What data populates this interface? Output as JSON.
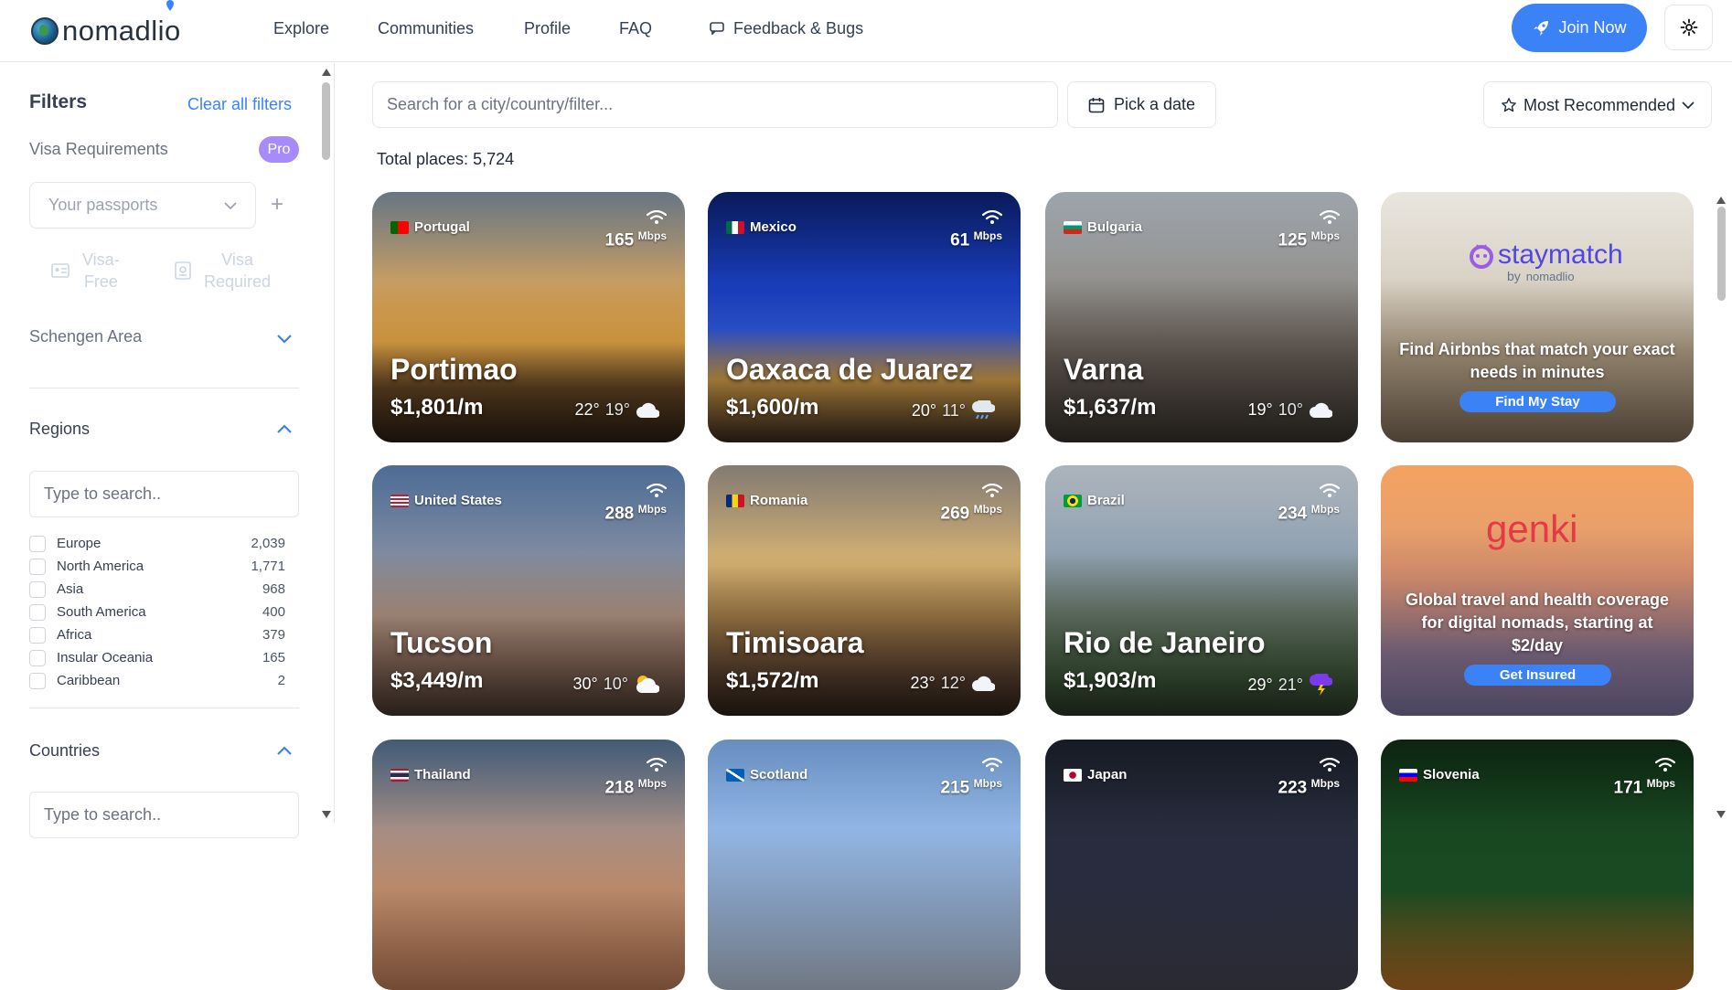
{
  "header": {
    "logo_text": "nomadlio",
    "nav": [
      "Explore",
      "Communities",
      "Profile",
      "FAQ"
    ],
    "feedback": "Feedback & Bugs",
    "join": "Join Now"
  },
  "sidebar": {
    "title": "Filters",
    "clear": "Clear all filters",
    "visa_label": "Visa Requirements",
    "pro": "Pro",
    "passports_placeholder": "Your passports",
    "visa_free": "Visa-\nFree",
    "visa_required": "Visa\nRequired",
    "schengen": "Schengen Area",
    "regions_title": "Regions",
    "regions_search": "Type to search..",
    "regions": [
      {
        "name": "Europe",
        "count": "2,039"
      },
      {
        "name": "North America",
        "count": "1,771"
      },
      {
        "name": "Asia",
        "count": "968"
      },
      {
        "name": "South America",
        "count": "400"
      },
      {
        "name": "Africa",
        "count": "379"
      },
      {
        "name": "Insular Oceania",
        "count": "165"
      },
      {
        "name": "Caribbean",
        "count": "2"
      }
    ],
    "countries_title": "Countries",
    "countries_search": "Type to search.."
  },
  "main": {
    "search_placeholder": "Search for a city/country/filter...",
    "date_label": "Pick a date",
    "sort_label": "Most Recommended",
    "total_label": "Total places: ",
    "total_value": "5,724",
    "mbps": "Mbps"
  },
  "cards": [
    {
      "country": "Portugal",
      "speed": "165",
      "city": "Portimao",
      "price": "$1,801/m",
      "high": "22°",
      "low": "19°",
      "weather": "cloud"
    },
    {
      "country": "Mexico",
      "speed": "61",
      "city": "Oaxaca de Juarez",
      "price": "$1,600/m",
      "high": "20°",
      "low": "11°",
      "weather": "rain"
    },
    {
      "country": "Bulgaria",
      "speed": "125",
      "city": "Varna",
      "price": "$1,637/m",
      "high": "19°",
      "low": "10°",
      "weather": "cloud"
    },
    {
      "country": "United States",
      "speed": "288",
      "city": "Tucson",
      "price": "$3,449/m",
      "high": "30°",
      "low": "10°",
      "weather": "partly-sunny"
    },
    {
      "country": "Romania",
      "speed": "269",
      "city": "Timisoara",
      "price": "$1,572/m",
      "high": "23°",
      "low": "12°",
      "weather": "cloud"
    },
    {
      "country": "Brazil",
      "speed": "234",
      "city": "Rio de Janeiro",
      "price": "$1,903/m",
      "high": "29°",
      "low": "21°",
      "weather": "storm"
    },
    {
      "country": "Thailand",
      "speed": "218"
    },
    {
      "country": "Scotland",
      "speed": "215"
    },
    {
      "country": "Japan",
      "speed": "223"
    },
    {
      "country": "Slovenia",
      "speed": "171"
    }
  ],
  "ads": {
    "staymatch": {
      "brand": "staymatch",
      "by": "by",
      "by_brand": "nomadlio",
      "text": "Find Airbnbs that match your exact needs in minutes",
      "button": "Find My Stay"
    },
    "genki": {
      "brand": "genki",
      "text": "Global travel and health coverage for digital nomads, starting at $2/day",
      "button": "Get Insured"
    }
  },
  "colors": {
    "accent": "#3b82f6",
    "pro": "#a78bfa",
    "genki": "#e63946"
  }
}
